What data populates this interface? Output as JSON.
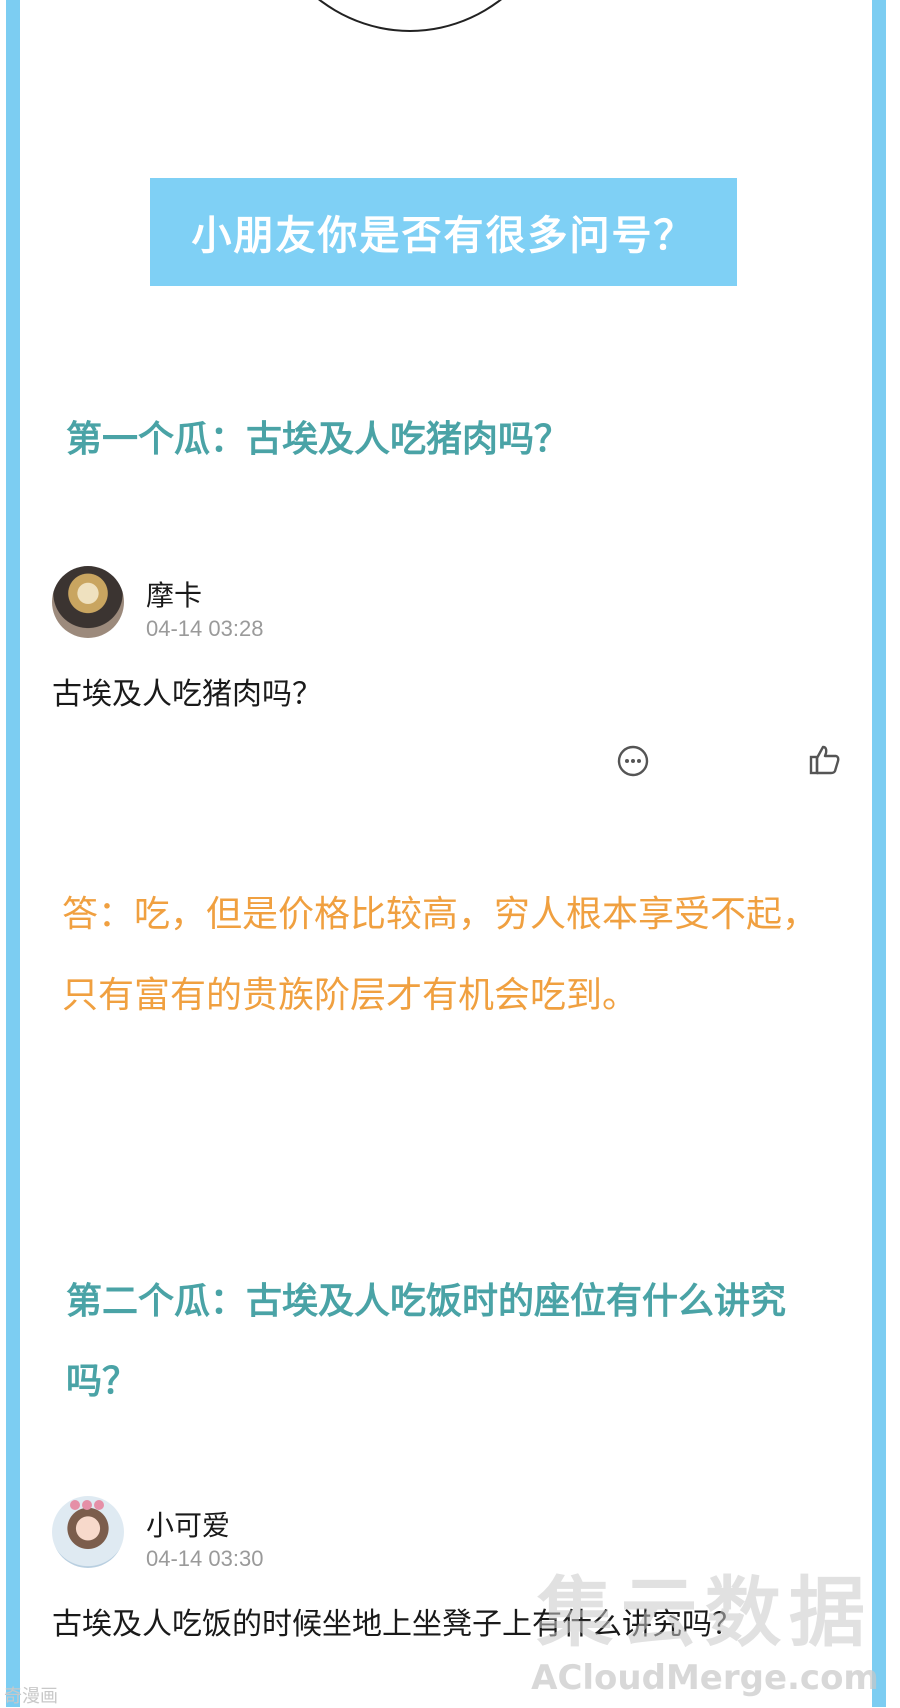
{
  "banner": {
    "title": "小朋友你是否有很多问号？"
  },
  "sections": [
    {
      "title": "第一个瓜：古埃及人吃猪肉吗？"
    },
    {
      "title": "第二个瓜：古埃及人吃饭时的座位有什么讲究吗？"
    }
  ],
  "comments": [
    {
      "username": "摩卡",
      "timestamp": "04-14 03:28",
      "text": "古埃及人吃猪肉吗？",
      "icons": [
        "comment-icon",
        "thumbs-up-icon"
      ]
    },
    {
      "username": "小可爱",
      "timestamp": "04-14 03:30",
      "text": "古埃及人吃饭的时候坐地上坐凳子上有什么讲究吗？"
    }
  ],
  "answer": {
    "text": "答：吃，但是价格比较高，穷人根本享受不起，只有富有的贵族阶层才有机会吃到。"
  },
  "watermark": {
    "big": "集云数据",
    "small": "ACloudMerge.com"
  },
  "source_mark": "奇漫画",
  "colors": {
    "border": "#7ccdf2",
    "banner": "#7fd0f5",
    "section_title": "#4aa3a6",
    "answer": "#f0a040"
  }
}
